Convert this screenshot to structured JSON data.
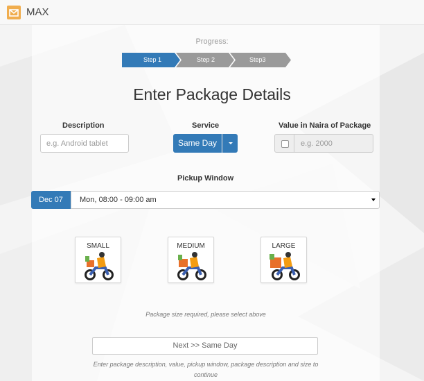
{
  "app": {
    "name": "MAX"
  },
  "progress": {
    "label": "Progress:",
    "steps": [
      {
        "label": "Step 1",
        "active": true
      },
      {
        "label": "Step 2",
        "active": false
      },
      {
        "label": "Step3",
        "active": false
      }
    ]
  },
  "title": "Enter Package Details",
  "fields": {
    "description": {
      "label": "Description",
      "placeholder": "e.g. Android tablet",
      "value": ""
    },
    "service": {
      "label": "Service",
      "selected": "Same Day"
    },
    "value": {
      "label": "Value in Naira of Package",
      "placeholder": "e.g. 2000",
      "checked": false
    }
  },
  "pickup": {
    "label": "Pickup Window",
    "date": "Dec 07",
    "selected": "Mon, 08:00 - 09:00 am"
  },
  "sizes": [
    {
      "label": "SMALL",
      "icon": "courier-scooter-icon"
    },
    {
      "label": "MEDIUM",
      "icon": "courier-scooter-icon"
    },
    {
      "label": "LARGE",
      "icon": "courier-scooter-icon"
    }
  ],
  "messages": {
    "size_required": "Package size required, please select above",
    "next_button": "Next >> Same Day",
    "footer": "Enter package description, value, pickup window, package description and size to continue"
  },
  "colors": {
    "primary": "#337ab7",
    "step_inactive": "#9a9a9a",
    "logo": "#f0ad4e"
  }
}
